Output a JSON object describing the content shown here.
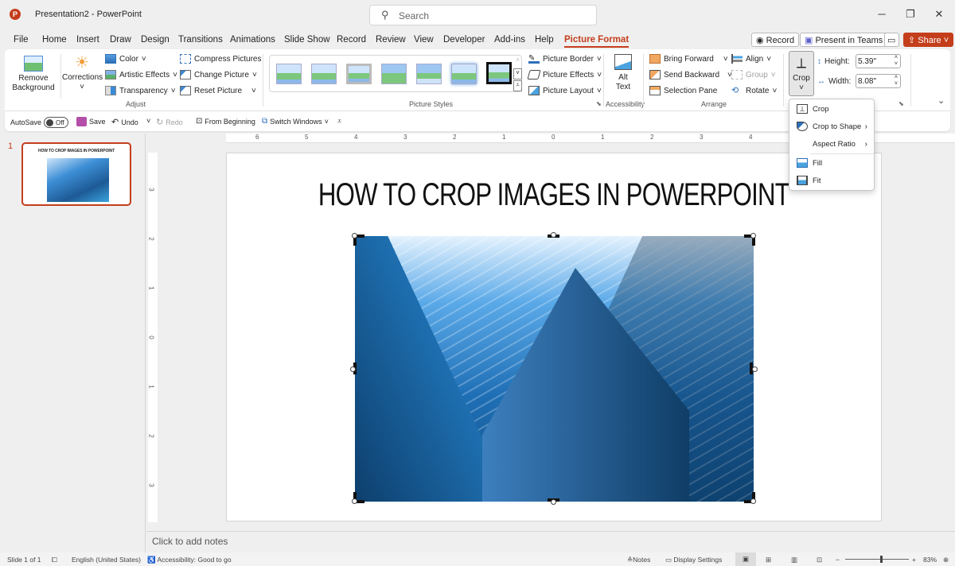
{
  "titlebar": {
    "app_icon": "powerpoint-logo",
    "app_icon_letter": "P",
    "title": "Presentation2 - PowerPoint",
    "search_placeholder": "Search",
    "minimize_glyph": "─",
    "restore_glyph": "❐",
    "close_glyph": "✕"
  },
  "menu": {
    "tabs": [
      "File",
      "Home",
      "Insert",
      "Draw",
      "Design",
      "Transitions",
      "Animations",
      "Slide Show",
      "Record",
      "Review",
      "View",
      "Developer",
      "Add-ins",
      "Help",
      "Picture Format"
    ],
    "active_tab": "Picture Format",
    "record_label": "Record",
    "present_teams_label": "Present in Teams",
    "share_label": "Share",
    "accent_color": "#c43e1c"
  },
  "ribbon": {
    "adjust": {
      "label": "Adjust",
      "remove_background": "Remove Background",
      "corrections": "Corrections",
      "color": "Color",
      "artistic_effects": "Artistic Effects",
      "transparency": "Transparency",
      "compress_pictures": "Compress Pictures",
      "change_picture": "Change Picture",
      "reset_picture": "Reset Picture"
    },
    "picture_styles": {
      "label": "Picture Styles",
      "style_count": 7,
      "picture_border": "Picture Border",
      "picture_effects": "Picture Effects",
      "picture_layout": "Picture Layout"
    },
    "accessibility": {
      "label": "Accessibility",
      "alt_text_line1": "Alt",
      "alt_text_line2": "Text"
    },
    "arrange": {
      "label": "Arrange",
      "bring_forward": "Bring Forward",
      "send_backward": "Send Backward",
      "selection_pane": "Selection Pane",
      "align": "Align",
      "group": "Group",
      "rotate": "Rotate"
    },
    "size": {
      "crop": "Crop",
      "height_label": "Height:",
      "height_value": "5.39\"",
      "width_label": "Width:",
      "width_value": "8.08\""
    }
  },
  "crop_menu": {
    "items": [
      {
        "label": "Crop",
        "icon": "crop-icon",
        "submenu": false
      },
      {
        "label": "Crop to Shape",
        "icon": "crop-to-shape-icon",
        "submenu": true
      },
      {
        "label": "Aspect Ratio",
        "icon": "",
        "submenu": true
      },
      {
        "label": "Fill",
        "icon": "fill-icon",
        "submenu": false
      },
      {
        "label": "Fit",
        "icon": "fit-icon",
        "submenu": false
      }
    ]
  },
  "qat": {
    "autosave_label": "AutoSave",
    "autosave_state": "Off",
    "save": "Save",
    "undo": "Undo",
    "redo": "Redo",
    "from_beginning": "From Beginning",
    "switch_windows": "Switch Windows"
  },
  "thumbnails": [
    {
      "number": "1",
      "title": "HOW TO CROP IMAGES IN POWERPOINT"
    }
  ],
  "rulers": {
    "horizontal": [
      "6",
      "5",
      "4",
      "3",
      "2",
      "1",
      "0",
      "1",
      "2",
      "3",
      "4"
    ],
    "vertical": [
      "3",
      "2",
      "1",
      "0",
      "1",
      "2",
      "3"
    ]
  },
  "slide": {
    "title": "HOW TO CROP IMAGES IN POWERPOINT",
    "image_description": "skyscraper-photo"
  },
  "notes": {
    "placeholder": "Click to add notes"
  },
  "status": {
    "slide_count": "Slide 1 of 1",
    "language": "English (United States)",
    "accessibility": "Accessibility: Good to go",
    "notes": "Notes",
    "display_settings": "Display Settings",
    "zoom_level": "83%",
    "zoom_fraction": 0.55
  }
}
